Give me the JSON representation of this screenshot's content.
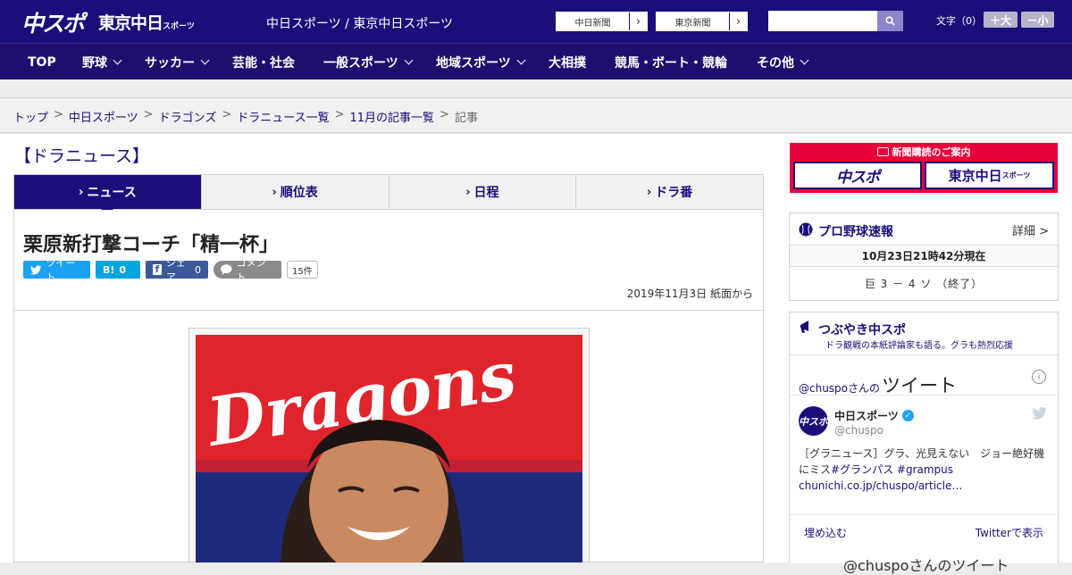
{
  "header": {
    "logo_chuspo": "中スポ",
    "logo_tokyo": "東京中日",
    "logo_tokyo_small": "スポーツ",
    "site_title": "中日スポーツ / 東京中日スポーツ",
    "paper_links": [
      "中日新聞",
      "東京新聞"
    ],
    "search_placeholder": "",
    "font_size_label": "文字（0）",
    "font_bigger": "＋大",
    "font_smaller": "－小"
  },
  "nav": {
    "items": [
      {
        "label": "TOP",
        "dropdown": false
      },
      {
        "label": "野球",
        "dropdown": true
      },
      {
        "label": "サッカー",
        "dropdown": true
      },
      {
        "label": "芸能・社会",
        "dropdown": false
      },
      {
        "label": "一般スポーツ",
        "dropdown": true
      },
      {
        "label": "地域スポーツ",
        "dropdown": true
      },
      {
        "label": "大相撲",
        "dropdown": false
      },
      {
        "label": "競馬・ボート・競輪",
        "dropdown": false
      },
      {
        "label": "その他",
        "dropdown": true
      }
    ]
  },
  "breadcrumb": {
    "links": [
      "トップ",
      "中日スポーツ",
      "ドラゴンズ",
      "ドラニュース一覧",
      "11月の記事一覧"
    ],
    "current": "記事",
    "separator": ">"
  },
  "section_title": "【ドラニュース】",
  "tabs": [
    {
      "label": "ニュース",
      "active": true
    },
    {
      "label": "順位表",
      "active": false
    },
    {
      "label": "日程",
      "active": false
    },
    {
      "label": "ドラ番",
      "active": false
    }
  ],
  "article": {
    "headline": "栗原新打撃コーチ「精一杯」",
    "share": {
      "tweet": "ツイート",
      "hatena": "B!",
      "hatena_count": "0",
      "facebook": "シェア",
      "facebook_count": "0",
      "comment": "コメント",
      "comment_count": "15件"
    },
    "date": "2019年11月3日 紙面から",
    "photo_text": "Dragons"
  },
  "sidebar": {
    "ad": {
      "title": "新聞購読のご案内",
      "logo_left": "中スポ",
      "logo_right": "東京中日",
      "logo_right_small": "スポーツ"
    },
    "baseball": {
      "title": "プロ野球速報",
      "detail": "詳細 >",
      "time": "10月23日21時42分現在",
      "score": "巨 3 － 4 ソ （終了）"
    },
    "tsubuyaki": {
      "title": "つぶやき中スポ",
      "subtitle": "ドラ観戦の本紙評論家も語る。グラも熱烈応援",
      "tweet_handle": "@chuspoさんの",
      "tweet_heading": "ツイート",
      "user_name": "中日スポーツ",
      "user_id": "@chuspo",
      "avatar_text": "中スポ",
      "tweet_body": "［グラニュース］グラ、光見えない　ジョー絶好機にミス",
      "tweet_tags": "#グランパス #grampus",
      "tweet_link": "chunichi.co.jp/chuspo/article…",
      "embed": "埋め込む",
      "view_on_twitter": "Twitterで表示",
      "next_heading": "@chuspoさんのツイート"
    }
  },
  "colors": {
    "brand_navy": "#1a0f7a",
    "nav_bg": "#1f0e6e",
    "ad_red": "#e8003a",
    "twitter_blue": "#1da1f2",
    "facebook_blue": "#3b5998"
  }
}
